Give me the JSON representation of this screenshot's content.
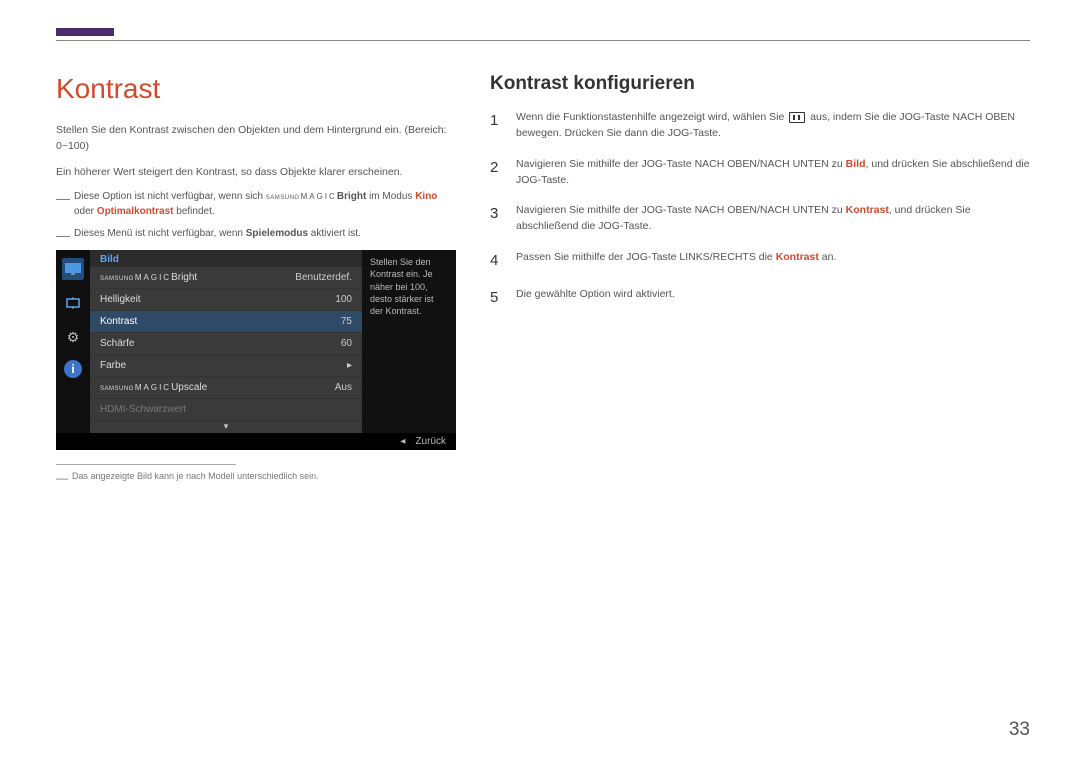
{
  "page_number": "33",
  "left": {
    "heading": "Kontrast",
    "intro": "Stellen Sie den Kontrast zwischen den Objekten und dem Hintergrund ein. (Bereich: 0~100)",
    "line2": "Ein höherer Wert steigert den Kontrast, so dass Objekte klarer erscheinen.",
    "note1_pre": "Diese Option ist nicht verfügbar, wenn sich",
    "note1_magic_sup": "SAMSUNG",
    "note1_magic_main": "MAGIC",
    "note1_bright": "Bright",
    "note1_mid": " im Modus ",
    "note1_kino": "Kino",
    "note1_oder": " oder ",
    "note1_optimal": "Optimalkontrast",
    "note1_end": " befindet.",
    "note2_pre": "Dieses Menü ist nicht verfügbar, wenn ",
    "note2_bold": "Spielemodus",
    "note2_end": " aktiviert ist.",
    "footnote": "Das angezeigte Bild kann je nach Modell unterschiedlich sein."
  },
  "osd": {
    "title": "Bild",
    "rows": [
      {
        "magic_sup": "SAMSUNG",
        "magic_main": "MAGIC",
        "label": "Bright",
        "value": "Benutzerdef."
      },
      {
        "label": "Helligkeit",
        "value": "100"
      },
      {
        "label": "Kontrast",
        "value": "75",
        "selected": true
      },
      {
        "label": "Schärfe",
        "value": "60"
      },
      {
        "label": "Farbe",
        "value": "▸"
      },
      {
        "magic_sup": "SAMSUNG",
        "magic_main": "MAGIC",
        "label": "Upscale",
        "value": "Aus"
      },
      {
        "label": "HDMI-Schwarzwert",
        "value": "",
        "disabled": true
      }
    ],
    "help": "Stellen Sie den Kontrast ein. Je näher bei 100, desto stärker ist der Kontrast.",
    "footer_back": "Zurück"
  },
  "right": {
    "heading": "Kontrast konfigurieren",
    "steps": {
      "s1a": "Wenn die Funktionstastenhilfe angezeigt wird, wählen Sie ",
      "s1b": " aus, indem Sie die JOG-Taste NACH OBEN bewegen. Drücken Sie dann die JOG-Taste.",
      "s2a": "Navigieren Sie mithilfe der JOG-Taste NACH OBEN/NACH UNTEN zu ",
      "s2bild": "Bild",
      "s2b": ", und drücken Sie abschließend die JOG-Taste.",
      "s3a": "Navigieren Sie mithilfe der JOG-Taste NACH OBEN/NACH UNTEN zu ",
      "s3k": "Kontrast",
      "s3b": ", und drücken Sie abschließend die JOG-Taste.",
      "s4a": "Passen Sie mithilfe der JOG-Taste LINKS/RECHTS die ",
      "s4k": "Kontrast",
      "s4b": " an.",
      "s5": "Die gewählte Option wird aktiviert."
    }
  }
}
